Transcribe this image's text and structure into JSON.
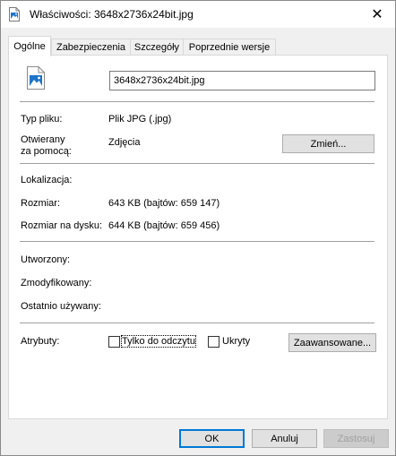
{
  "window": {
    "title": "Właściwości: 3648x2736x24bit.jpg",
    "close_glyph": "✕"
  },
  "tabs": [
    {
      "label": "Ogólne",
      "active": true
    },
    {
      "label": "Zabezpieczenia",
      "active": false
    },
    {
      "label": "Szczegóły",
      "active": false
    },
    {
      "label": "Poprzednie wersje",
      "active": false
    }
  ],
  "general": {
    "file_name": "3648x2736x24bit.jpg",
    "file_type_label": "Typ pliku:",
    "file_type_value": "Plik JPG (.jpg)",
    "opens_with_label_1": "Otwierany",
    "opens_with_label_2": "za pomocą:",
    "opens_with_value": "Zdjęcia",
    "change_button": "Zmień...",
    "location_label": "Lokalizacja:",
    "location_value": "",
    "size_label": "Rozmiar:",
    "size_value": "643 KB (bajtów: 659 147)",
    "size_on_disk_label": "Rozmiar na dysku:",
    "size_on_disk_value": "644 KB (bajtów: 659 456)",
    "created_label": "Utworzony:",
    "modified_label": "Zmodyfikowany:",
    "accessed_label": "Ostatnio używany:",
    "attributes_label": "Atrybuty:",
    "readonly_label": "Tylko do odczytu",
    "readonly_checked": false,
    "hidden_label": "Ukryty",
    "hidden_checked": false,
    "advanced_button": "Zaawansowane..."
  },
  "footer": {
    "ok": "OK",
    "cancel": "Anuluj",
    "apply": "Zastosuj"
  },
  "colors": {
    "accent": "#0078d7",
    "image_icon": "#1e74c8"
  }
}
